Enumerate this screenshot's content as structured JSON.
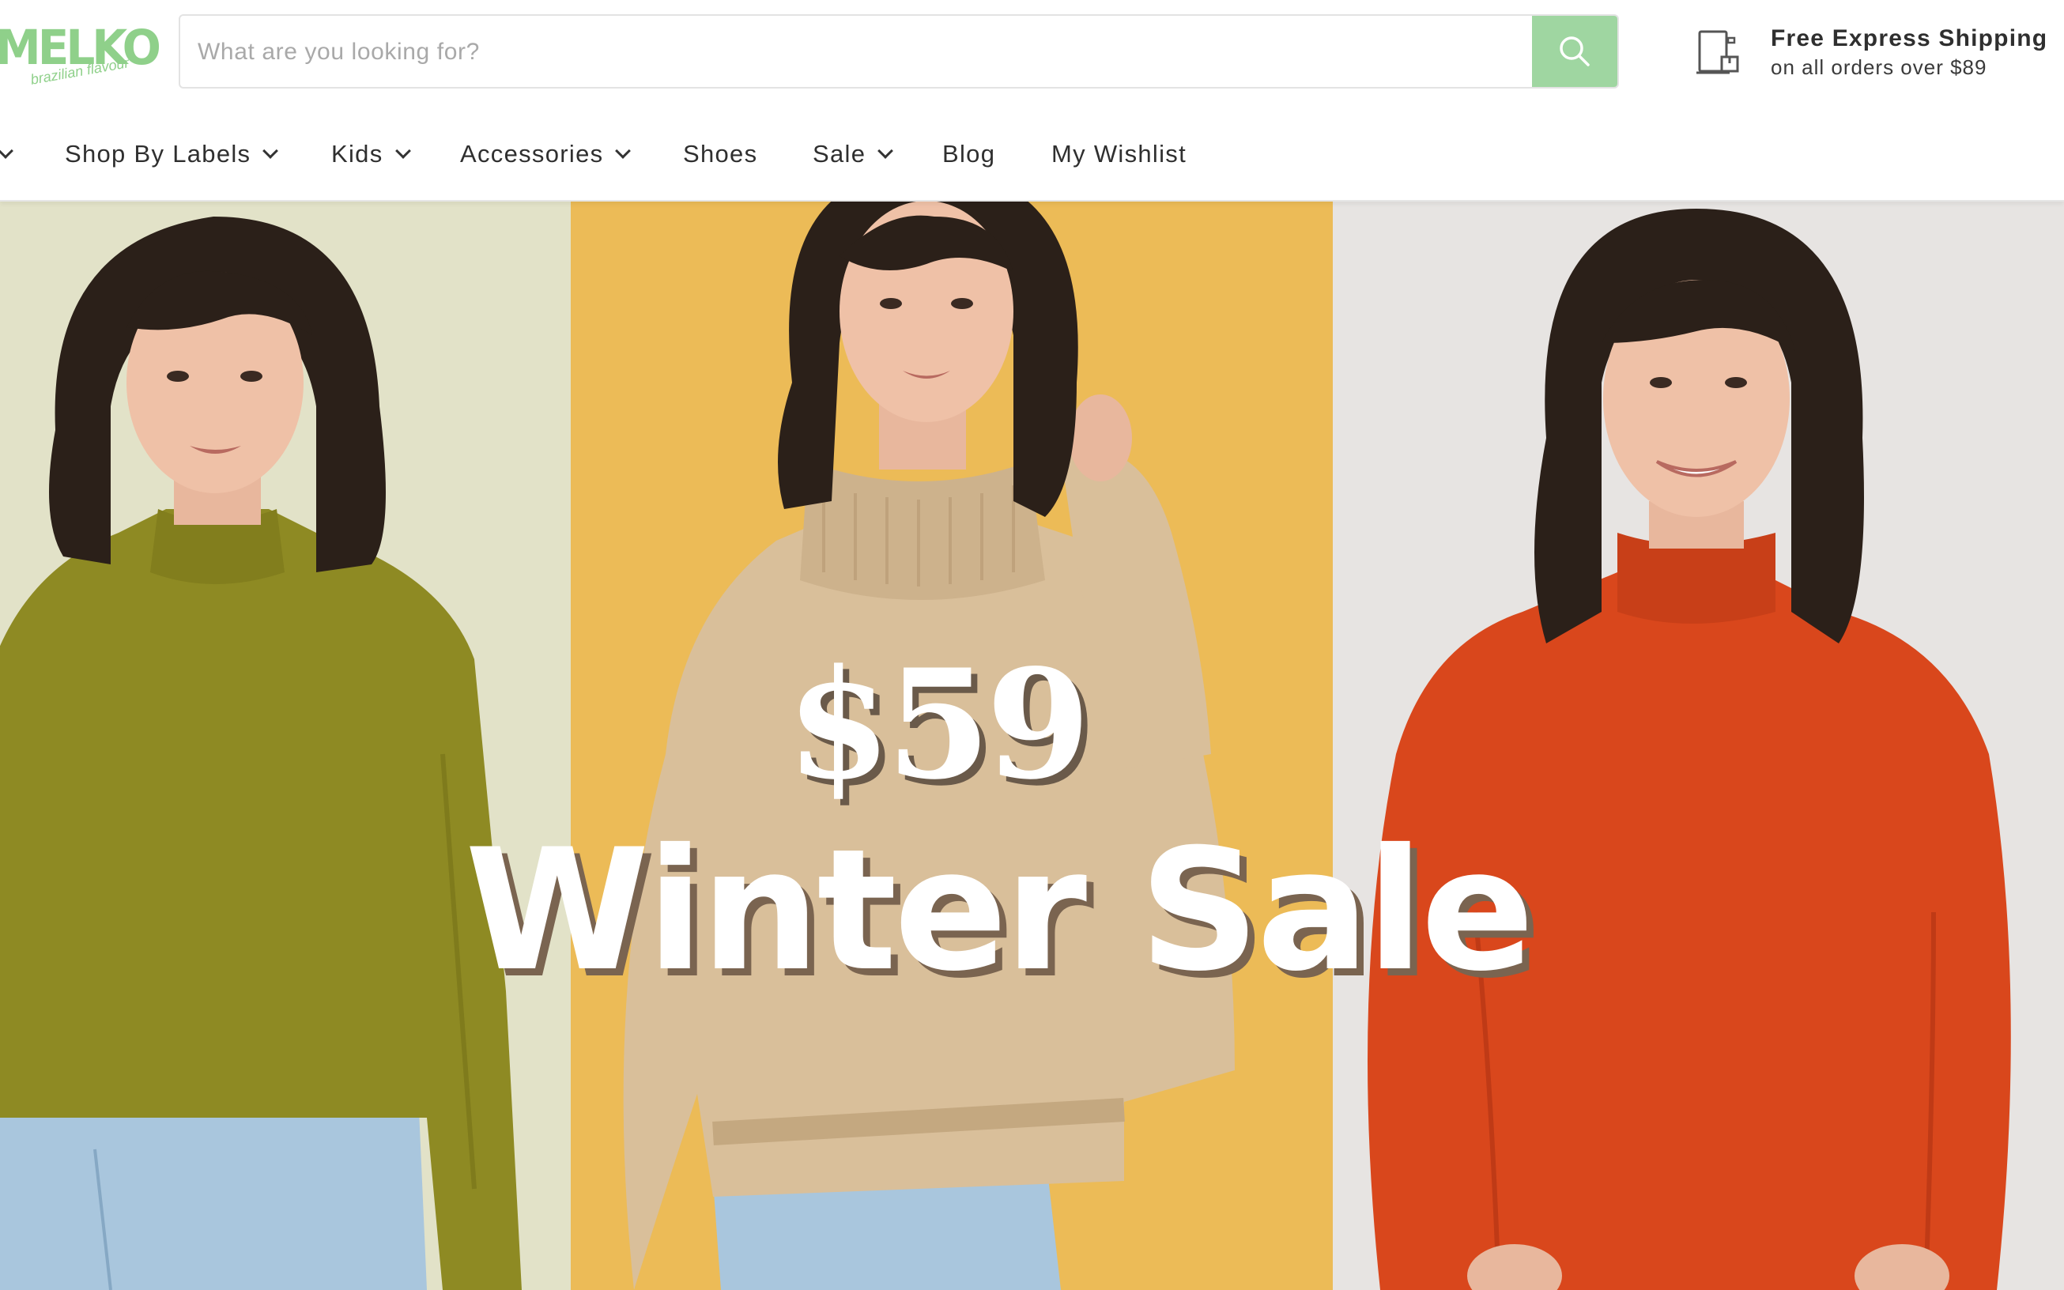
{
  "header": {
    "logo": {
      "name": "MELKO",
      "tagline": "brazilian flavour"
    },
    "search": {
      "placeholder": "What are you looking for?",
      "value": ""
    },
    "shipping": {
      "title": "Free Express Shipping",
      "subtitle": "on all orders over $89"
    }
  },
  "nav": {
    "items": [
      {
        "label": "",
        "has_dropdown": true
      },
      {
        "label": "Shop By Labels",
        "has_dropdown": true
      },
      {
        "label": "Kids",
        "has_dropdown": true
      },
      {
        "label": "Accessories",
        "has_dropdown": true
      },
      {
        "label": "Shoes",
        "has_dropdown": false
      },
      {
        "label": "Sale",
        "has_dropdown": true
      },
      {
        "label": "Blog",
        "has_dropdown": false
      },
      {
        "label": "My Wishlist",
        "has_dropdown": false
      }
    ]
  },
  "hero": {
    "price": "$59",
    "title": "Winter Sale",
    "panels": [
      {
        "background": "#e2e2c8",
        "top_color": "#8e8a23"
      },
      {
        "background": "#ecbb57",
        "top_color": "#d9bf9a"
      },
      {
        "background": "#e7e4e2",
        "top_color": "#d9471c"
      }
    ]
  },
  "colors": {
    "accent": "#9fd6a1",
    "text": "#2f2f2f"
  }
}
